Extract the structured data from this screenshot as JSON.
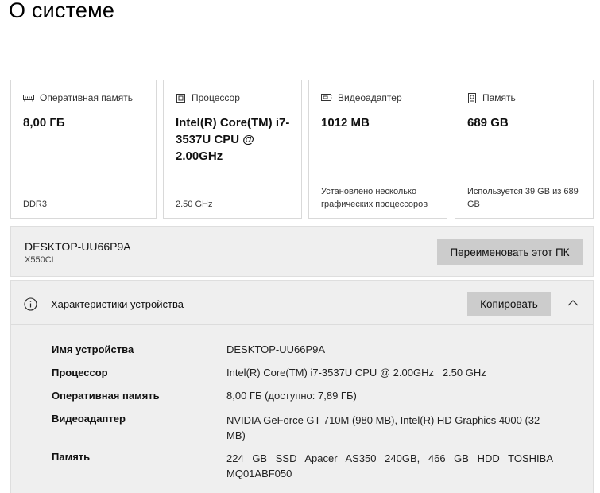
{
  "page": {
    "title": "О системе"
  },
  "cards": [
    {
      "icon": "ram-icon",
      "label": "Оперативная память",
      "value": "8,00 ГБ",
      "sub": "DDR3"
    },
    {
      "icon": "processor-icon",
      "label": "Процессор",
      "value": "Intel(R) Core(TM) i7-3537U CPU @ 2.00GHz",
      "sub": "2.50 GHz"
    },
    {
      "icon": "display-adapter-icon",
      "label": "Видеоадаптер",
      "value": "1012 MB",
      "sub": "Установлено несколько графических процессоров"
    },
    {
      "icon": "storage-icon",
      "label": "Память",
      "value": "689 GB",
      "sub": "Используется 39 GB из 689 GB"
    }
  ],
  "device": {
    "name": "DESKTOP-UU66P9A",
    "model": "X550CL",
    "rename_label": "Переименовать этот ПК"
  },
  "specs": {
    "title": "Характеристики устройства",
    "copy_label": "Копировать",
    "info_icon": "info-icon",
    "collapse_icon": "chevron-up-icon",
    "rows": [
      {
        "label": "Имя устройства",
        "value": "DESKTOP-UU66P9A"
      },
      {
        "label": "Процессор",
        "value": "Intel(R) Core(TM) i7-3537U CPU @ 2.00GHz   2.50 GHz"
      },
      {
        "label": "Оперативная память",
        "value": "8,00 ГБ (доступно: 7,89 ГБ)"
      },
      {
        "label": "Видеоадаптер",
        "value": "NVIDIA GeForce GT 710M (980 MB), Intel(R) HD Graphics 4000 (32 MB)"
      },
      {
        "label": "Память",
        "value": "224 GB SSD Apacer AS350 240GB, 466 GB HDD TOSHIBA MQ01ABF050"
      }
    ]
  }
}
